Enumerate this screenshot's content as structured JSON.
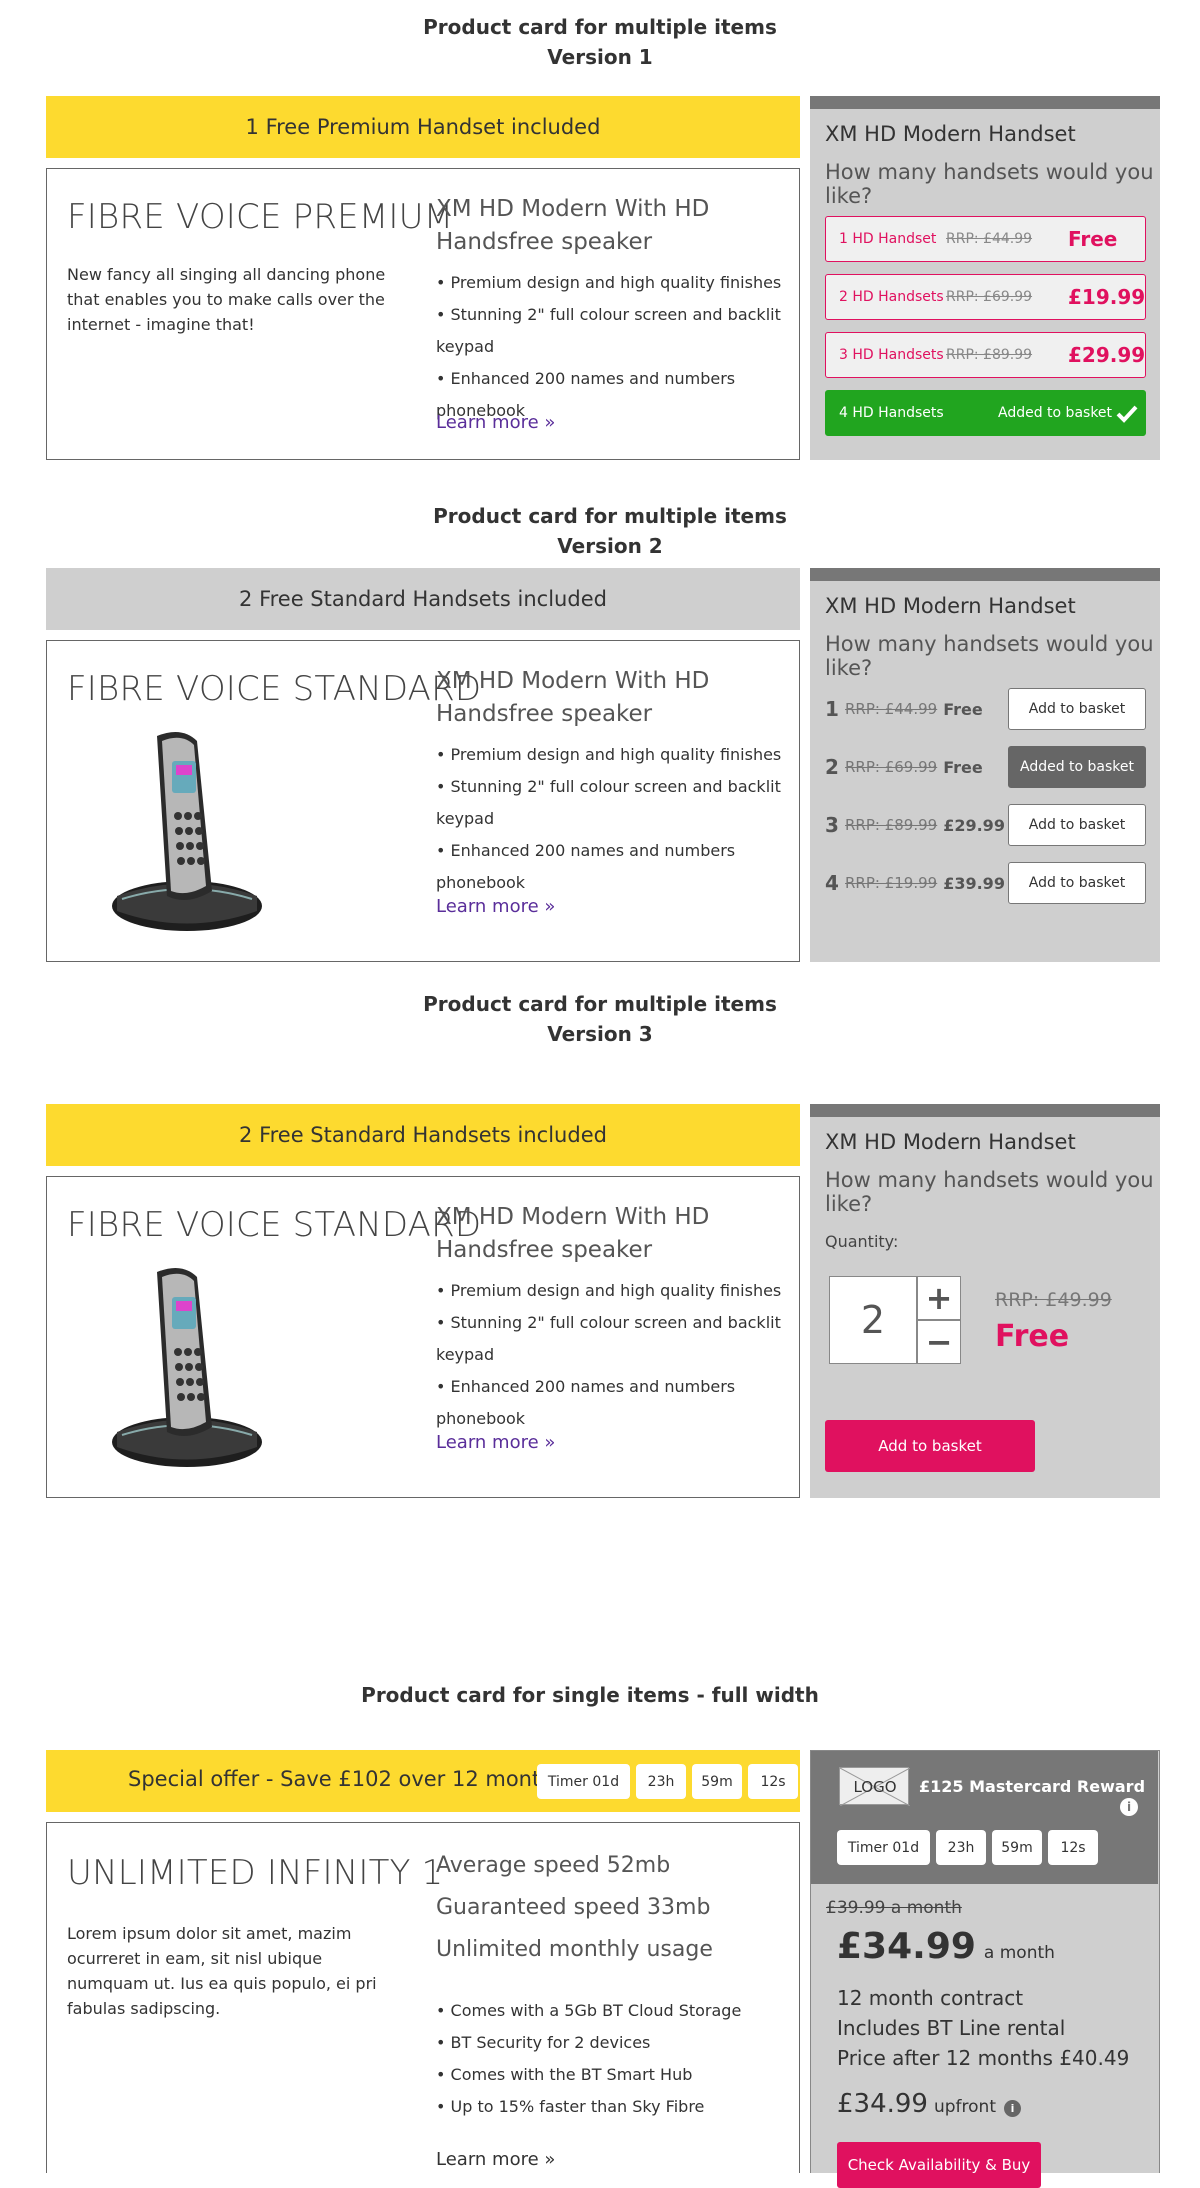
{
  "colors": {
    "yellow": "#fdda2f",
    "pink": "#e0115f",
    "green": "#21a51f",
    "purple": "#5a2e9a",
    "panel_grey": "#cfcfcf"
  },
  "v1": {
    "heading_line1": "Product card for multiple items",
    "heading_line2": "Version 1",
    "banner": "1 Free Premium Handset included",
    "title": "FIBRE VOICE PREMIUM",
    "description": "New fancy all singing all dancing phone that enables you to make calls over the internet - imagine that!",
    "subtitle": "XM HD Modern With HD Handsfree speaker",
    "bullets": [
      "• Premium design and high quality finishes",
      "• Stunning 2\" full colour screen and backlit keypad",
      "• Enhanced 200 names and numbers phonebook"
    ],
    "learn_more": "Learn more »",
    "panel_title": "XM HD Modern Handset",
    "panel_question": "How many handsets would you like?",
    "options": [
      {
        "label": "1 HD Handset",
        "rrp": "RRP: £44.99",
        "price": "Free"
      },
      {
        "label": "2 HD Handsets",
        "rrp": "RRP: £69.99",
        "price": "£19.99"
      },
      {
        "label": "3 HD Handsets",
        "rrp": "RRP: £89.99",
        "price": "£29.99"
      },
      {
        "label": "4 HD Handsets",
        "status": "Added to basket"
      }
    ]
  },
  "v2": {
    "heading_line1": "Product card for multiple items",
    "heading_line2": "Version 2",
    "banner": "2 Free Standard Handsets included",
    "title": "FIBRE VOICE STANDARD",
    "subtitle": "XM HD Modern With HD Handsfree speaker",
    "bullets": [
      "• Premium design and high quality finishes",
      "• Stunning 2\" full colour screen and backlit keypad",
      "• Enhanced 200 names and numbers phonebook"
    ],
    "learn_more": "Learn more »",
    "panel_title": "XM HD Modern Handset",
    "panel_question": "How many handsets would you like?",
    "rows": [
      {
        "num": "1",
        "rrp": "RRP: £44.99",
        "price": "Free",
        "button": "Add to basket"
      },
      {
        "num": "2",
        "rrp": "RRP: £69.99",
        "price": "Free",
        "button": "Added to basket"
      },
      {
        "num": "3",
        "rrp": "RRP: £89.99",
        "price": "£29.99",
        "button": "Add to basket"
      },
      {
        "num": "4",
        "rrp": "RRP: £19.99",
        "price": "£39.99",
        "button": "Add to basket"
      }
    ]
  },
  "v3": {
    "heading_line1": "Product card for multiple items",
    "heading_line2": "Version 3",
    "banner": "2 Free Standard Handsets included",
    "title": "FIBRE VOICE STANDARD",
    "subtitle": "XM HD Modern With HD Handsfree speaker",
    "bullets": [
      "• Premium design and high quality finishes",
      "• Stunning 2\" full colour screen and backlit keypad",
      "• Enhanced 200 names and numbers phonebook"
    ],
    "learn_more": "Learn more »",
    "panel_title": "XM HD Modern Handset",
    "panel_question": "How many handsets would you like?",
    "quantity_label": "Quantity:",
    "quantity": "2",
    "plus": "+",
    "minus": "−",
    "rrp": "RRP: £49.99",
    "price": "Free",
    "add_button": "Add to basket"
  },
  "single": {
    "heading": "Product card for single items - full width",
    "banner": "Special offer - Save £102 over 12 months",
    "timers": [
      "Timer 01d",
      "23h",
      "59m",
      "12s"
    ],
    "title": "UNLIMITED INFINITY 1",
    "description": "Lorem ipsum dolor sit amet, mazim ocurreret in eam, sit nisl ubique numquam ut. Ius ea quis populo, ei pri fabulas sadipscing.",
    "speeds": [
      "Average speed 52mb",
      "Guaranteed speed 33mb",
      "Unlimited monthly usage"
    ],
    "bullets": [
      "• Comes with a 5Gb BT Cloud Storage",
      "• BT Security for 2 devices",
      "• Comes with the BT Smart Hub",
      "• Up to 15% faster than Sky Fibre"
    ],
    "learn_more": "Learn more »",
    "logo": "LOGO",
    "reward": "£125 Mastercard Reward",
    "info_icon": "i",
    "panel_timers": [
      "Timer 01d",
      "23h",
      "59m",
      "12s"
    ],
    "old_price": "£39.99 a month",
    "price": "£34.99",
    "price_suffix": "a month",
    "contract_lines": [
      "12 month contract",
      "Includes BT Line rental",
      "Price after 12 months £40.49"
    ],
    "upfront_price": "£34.99",
    "upfront_label": "upfront",
    "cta": "Check Availability & Buy"
  }
}
